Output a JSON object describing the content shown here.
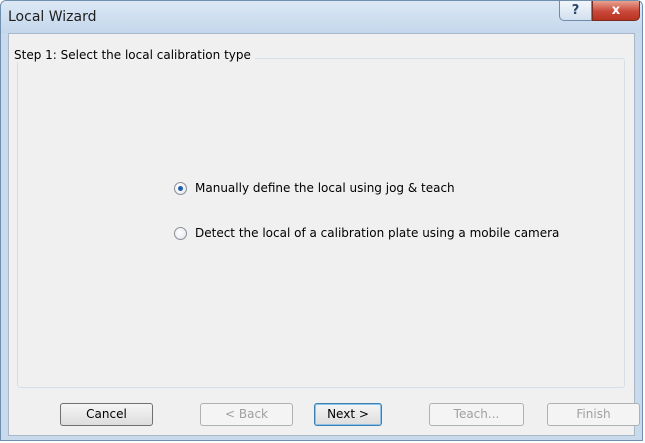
{
  "window": {
    "title": "Local Wizard",
    "help_label": "?",
    "close_label": "x"
  },
  "step": {
    "caption": "Step 1: Select the local calibration type"
  },
  "options": [
    {
      "label": "Manually define the local using jog & teach",
      "selected": true
    },
    {
      "label": "Detect the local of a calibration plate using a mobile camera",
      "selected": false
    }
  ],
  "buttons": {
    "cancel": {
      "label": "Cancel",
      "enabled": true
    },
    "back": {
      "label": "< Back",
      "enabled": false
    },
    "next": {
      "label": "Next >",
      "enabled": true
    },
    "teach": {
      "label": "Teach...",
      "enabled": false
    },
    "finish": {
      "label": "Finish",
      "enabled": false
    }
  },
  "colors": {
    "title_bar": "#c4d7ec",
    "close_button": "#c9483a",
    "selected_radio": "#1f5fa8"
  }
}
